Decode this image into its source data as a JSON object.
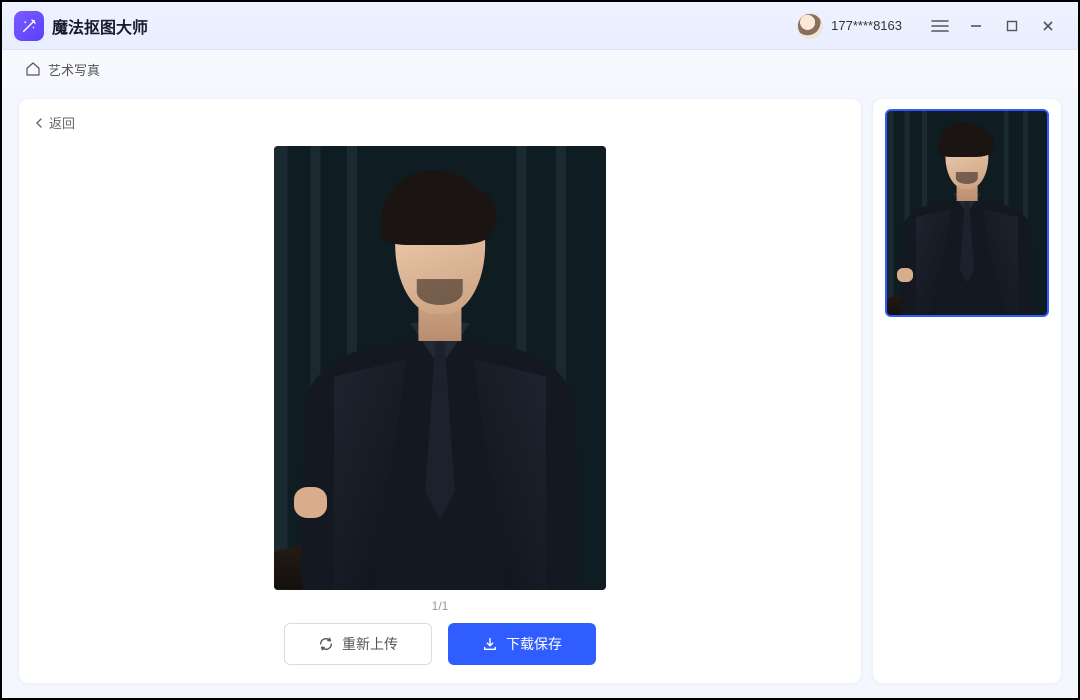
{
  "app": {
    "title": "魔法抠图大师"
  },
  "user": {
    "phone": "177****8163"
  },
  "breadcrumb": {
    "label": "艺术写真"
  },
  "back": {
    "label": "返回"
  },
  "pager": {
    "text": "1/1"
  },
  "actions": {
    "reupload": "重新上传",
    "download": "下载保存"
  }
}
